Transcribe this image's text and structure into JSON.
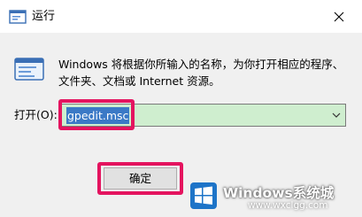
{
  "window": {
    "title": "运行",
    "close_icon": "close-icon"
  },
  "dialog": {
    "icon": "run-dialog-icon",
    "description": "Windows 将根据你所输入的名称，为你打开相应的程序、文件夹、文档或 Internet 资源。",
    "open_label": "打开(O):",
    "open_value": "gpedit.msc",
    "ok_label": "确定"
  },
  "watermark": {
    "brand": "Windows系统城",
    "url": "www.wxclgg.com"
  },
  "colors": {
    "highlight": "#e4145f",
    "selection": "#3b79c6",
    "input_bg": "#cfeecf"
  }
}
